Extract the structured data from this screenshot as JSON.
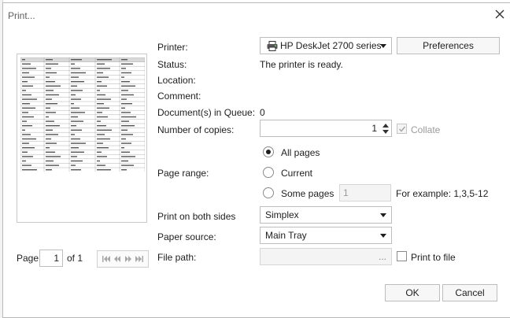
{
  "dialog": {
    "title": "Print..."
  },
  "printer": {
    "label": "Printer:",
    "selected": "HP DeskJet 2700 series",
    "preferences_label": "Preferences",
    "status_label": "Status:",
    "status_value": "The printer is ready.",
    "location_label": "Location:",
    "comment_label": "Comment:",
    "queue_label": "Document(s) in Queue:",
    "queue_value": "0"
  },
  "copies": {
    "label": "Number of copies:",
    "value": "1",
    "collate_label": "Collate",
    "collate_checked": true
  },
  "page_range": {
    "label": "Page range:",
    "options": [
      "All pages",
      "Current",
      "Some pages"
    ],
    "selected": "All pages",
    "some_pages_value": "1",
    "example": "For example: 1,3,5-12"
  },
  "duplex": {
    "label": "Print on both sides",
    "selected": "Simplex"
  },
  "paper_source": {
    "label": "Paper source:",
    "selected": "Main Tray"
  },
  "file_path": {
    "label": "File path:",
    "value": "",
    "browse_label": "...",
    "print_to_file_label": "Print to file"
  },
  "pager": {
    "label": "Page",
    "current": "1",
    "of_label": "of 1"
  },
  "buttons": {
    "ok": "OK",
    "cancel": "Cancel"
  },
  "colors": {
    "accent_check": "#8a8a8a",
    "border": "#bdbdbd",
    "disabled_text": "#9a9a9a"
  }
}
